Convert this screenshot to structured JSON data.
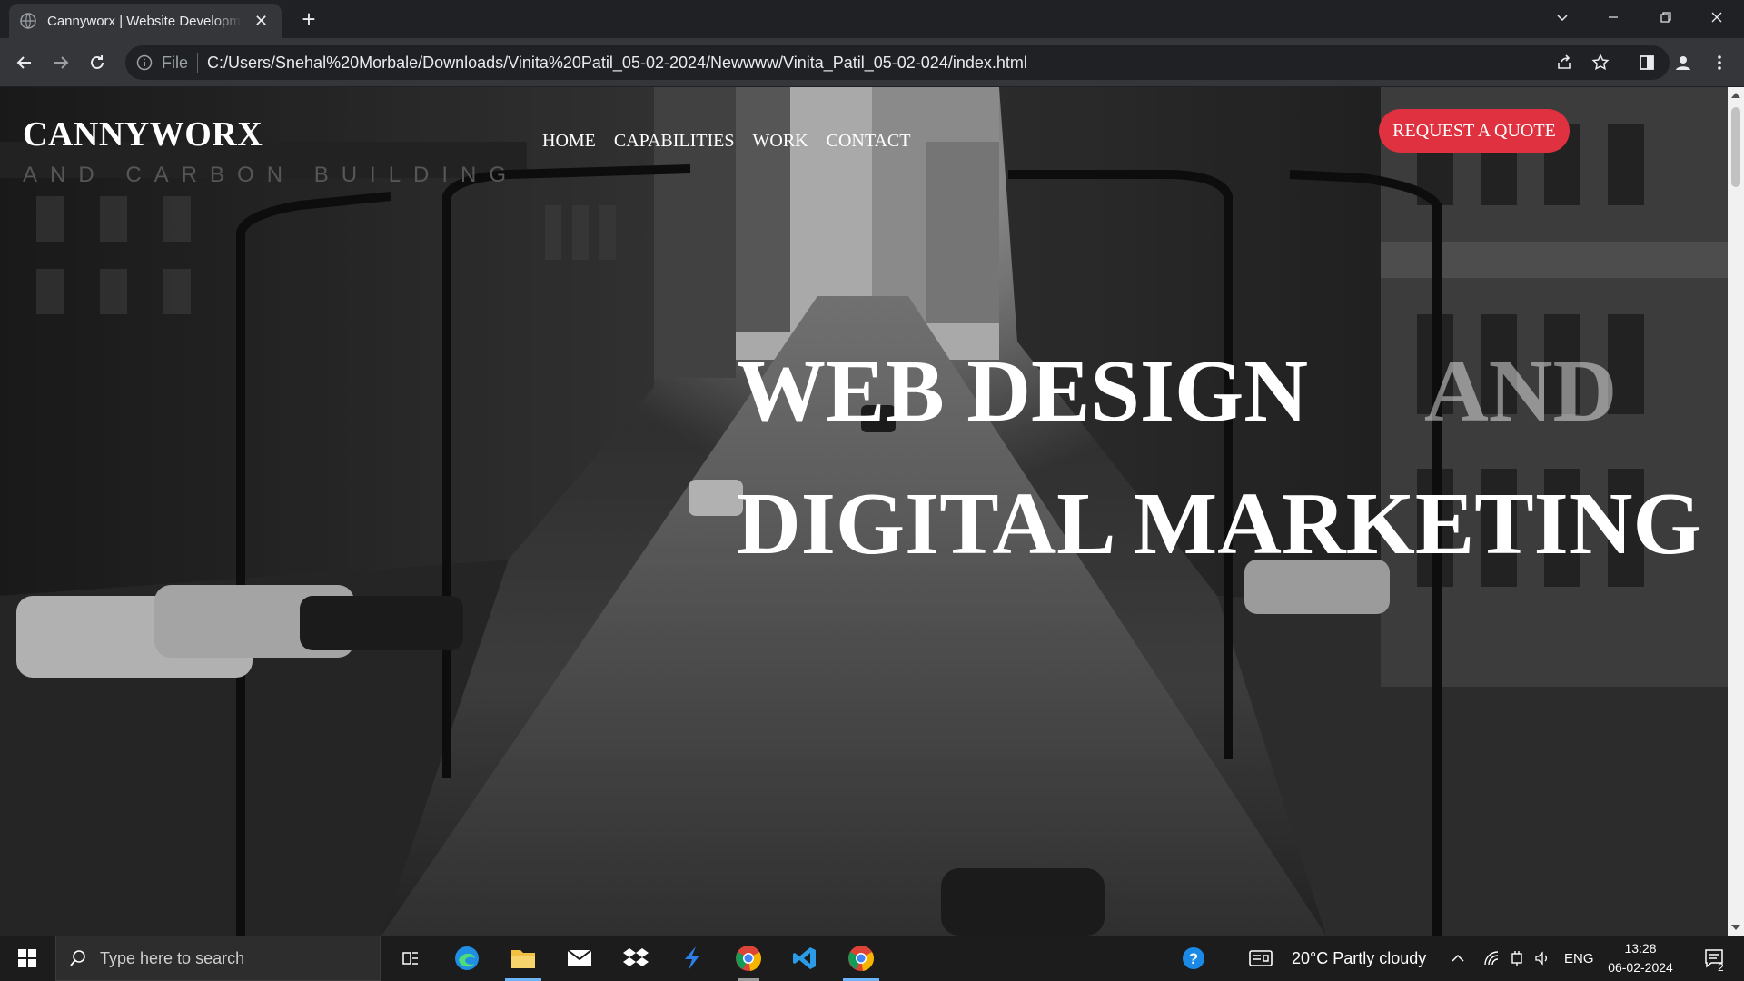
{
  "browser": {
    "tab_title": "Cannyworx | Website Development",
    "address_scheme": "File",
    "address_url": "C:/Users/Snehal%20Morbale/Downloads/Vinita%20Patil_05-02-2024/Newwww/Vinita_Patil_05-02-024/index.html"
  },
  "site": {
    "brand": "CANNYWORX",
    "nav": [
      "HOME",
      "CAPABILITIES",
      "WORK",
      "CONTACT"
    ],
    "cta": "REQUEST A QUOTE",
    "headline_line1": "WEB DESIGN",
    "headline_faded": "AND",
    "headline_line2": "DIGITAL MARKETING",
    "accent_color": "#e03140"
  },
  "taskbar": {
    "search_placeholder": "Type here to search",
    "weather": "20°C  Partly cloudy",
    "language": "ENG",
    "time": "13:28",
    "date": "06-02-2024",
    "notification_count": "2"
  }
}
